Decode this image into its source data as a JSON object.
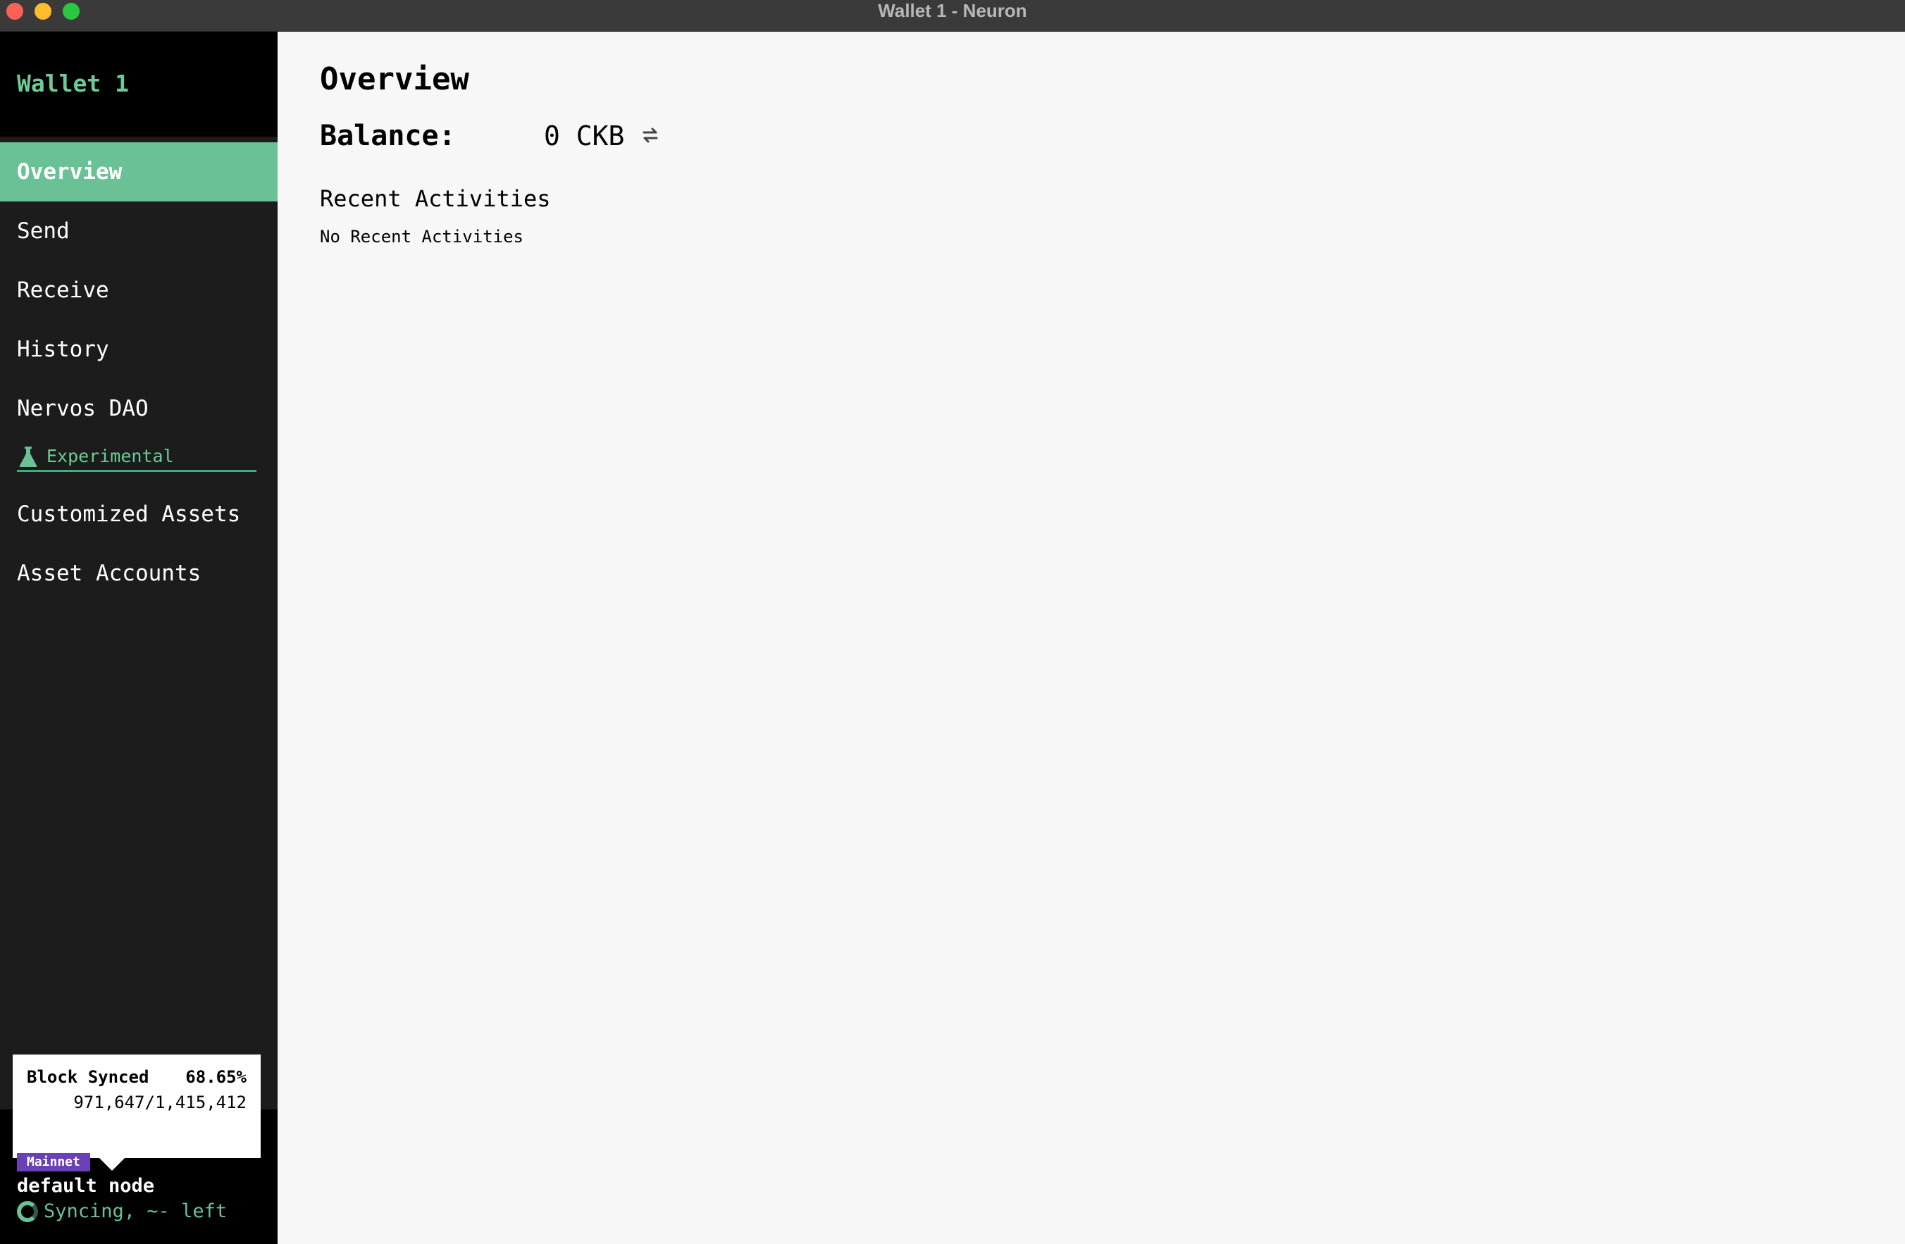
{
  "window": {
    "title": "Wallet 1 - Neuron"
  },
  "sidebar": {
    "wallet_name": "Wallet 1",
    "items": [
      {
        "label": "Overview",
        "active": true
      },
      {
        "label": "Send"
      },
      {
        "label": "Receive"
      },
      {
        "label": "History"
      },
      {
        "label": "Nervos DAO"
      }
    ],
    "experimental": {
      "label": "Experimental",
      "icon": "flask-icon"
    },
    "experimental_items": [
      {
        "label": "Customized Assets"
      },
      {
        "label": "Asset Accounts"
      }
    ],
    "sync_tooltip": {
      "title": "Block Synced",
      "percent": "68.65%",
      "blocks": "971,647/1,415,412"
    },
    "network": {
      "badge": "Mainnet",
      "node": "default node",
      "status": "Syncing, ~- left"
    }
  },
  "main": {
    "title": "Overview",
    "balance_label": "Balance:",
    "balance_value": "0 CKB",
    "recent_title": "Recent Activities",
    "recent_empty": "No Recent Activities"
  },
  "colors": {
    "accent": "#6ac195",
    "sidebar_bg": "#1c1c1c",
    "network_badge": "#6b3fb5"
  }
}
